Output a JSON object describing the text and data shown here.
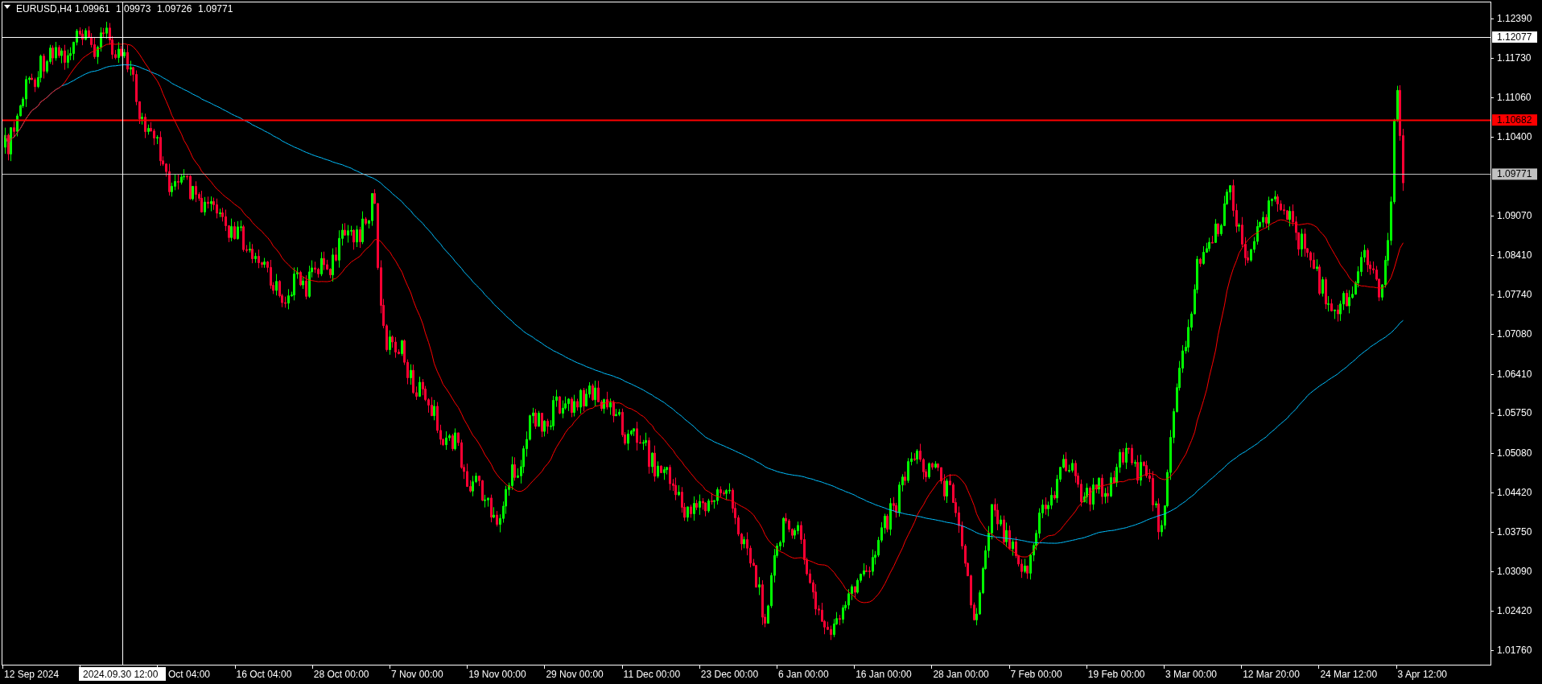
{
  "chart": {
    "symbol": "EURUSD,H4",
    "ohlc": [
      "1.09961",
      "1.09973",
      "1.09726",
      "1.09771"
    ],
    "price_ticks": [
      "1.12390",
      "1.11730",
      "1.11060",
      "1.10400",
      "1.09070",
      "1.08410",
      "1.07740",
      "1.07080",
      "1.06410",
      "1.05750",
      "1.05080",
      "1.04420",
      "1.03750",
      "1.03090",
      "1.02420",
      "1.01760"
    ],
    "time_ticks": [
      "12 Sep 2024",
      "Oct 04:00",
      "16 Oct 04:00",
      "28 Oct 00:00",
      "7 Nov 00:00",
      "19 Nov 00:00",
      "29 Nov 00:00",
      "11 Dec 00:00",
      "23 Dec 00:00",
      "6 Jan 00:00",
      "16 Jan 00:00",
      "28 Jan 00:00",
      "7 Feb 00:00",
      "19 Feb 00:00",
      "3 Mar 00:00",
      "12 Mar 20:00",
      "24 Mar 12:00",
      "3 Apr 12:00"
    ],
    "crosshair": {
      "time_label": "2024.09.30 12:00",
      "price_label": "1.12077"
    },
    "price_lines": [
      {
        "label": "1.10682",
        "color": "#ff0000"
      },
      {
        "label": "1.09771",
        "color": "#c0c0c0"
      }
    ]
  }
}
